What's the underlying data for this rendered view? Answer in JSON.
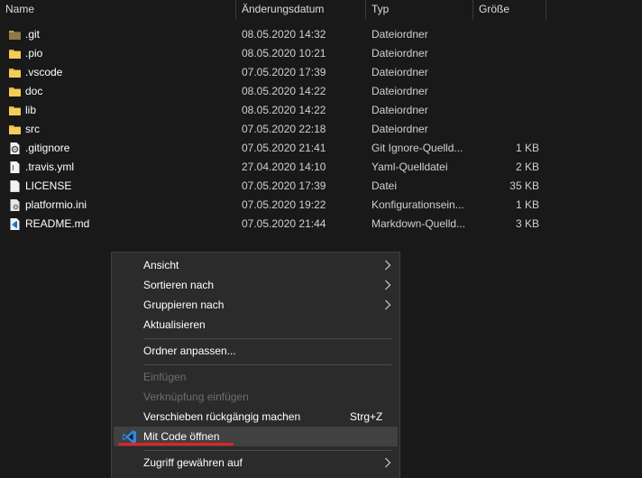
{
  "columns": {
    "name": "Name",
    "date": "Änderungsdatum",
    "type": "Typ",
    "size": "Größe"
  },
  "files": [
    {
      "name": ".git",
      "date": "08.05.2020 14:32",
      "type": "Dateiordner",
      "size": "",
      "icon": "folder-icon"
    },
    {
      "name": ".pio",
      "date": "08.05.2020 10:21",
      "type": "Dateiordner",
      "size": "",
      "icon": "folder-icon"
    },
    {
      "name": ".vscode",
      "date": "07.05.2020 17:39",
      "type": "Dateiordner",
      "size": "",
      "icon": "folder-icon"
    },
    {
      "name": "doc",
      "date": "08.05.2020 14:22",
      "type": "Dateiordner",
      "size": "",
      "icon": "folder-icon"
    },
    {
      "name": "lib",
      "date": "08.05.2020 14:22",
      "type": "Dateiordner",
      "size": "",
      "icon": "folder-icon"
    },
    {
      "name": "src",
      "date": "07.05.2020 22:18",
      "type": "Dateiordner",
      "size": "",
      "icon": "folder-icon"
    },
    {
      "name": ".gitignore",
      "date": "07.05.2020 21:41",
      "type": "Git Ignore-Quelld...",
      "size": "1 KB",
      "icon": "gear-file-icon"
    },
    {
      "name": ".travis.yml",
      "date": "27.04.2020 14:10",
      "type": "Yaml-Quelldatei",
      "size": "2 KB",
      "icon": "file-icon"
    },
    {
      "name": "LICENSE",
      "date": "07.05.2020 17:39",
      "type": "Datei",
      "size": "35 KB",
      "icon": "file-icon"
    },
    {
      "name": "platformio.ini",
      "date": "07.05.2020 19:22",
      "type": "Konfigurationsein...",
      "size": "1 KB",
      "icon": "settings-file-icon"
    },
    {
      "name": "README.md",
      "date": "07.05.2020 21:44",
      "type": "Markdown-Quelld...",
      "size": "3 KB",
      "icon": "vscode-file-icon"
    }
  ],
  "context_menu": {
    "view": "Ansicht",
    "sort_by": "Sortieren nach",
    "group_by": "Gruppieren nach",
    "refresh": "Aktualisieren",
    "customize_folder": "Ordner anpassen...",
    "paste": "Einfügen",
    "paste_shortcut": "Verknüpfung einfügen",
    "undo_move": "Verschieben rückgängig machen",
    "undo_shortcut": "Strg+Z",
    "open_with_code": "Mit Code öffnen",
    "give_access": "Zugriff gewähren auf"
  },
  "colors": {
    "background": "#191919",
    "menu_bg": "#2b2b2b",
    "highlight": "#414141",
    "folder": "#f0c24a",
    "accent_underline": "#e0242a",
    "vscode_blue": "#2b8ae0"
  }
}
